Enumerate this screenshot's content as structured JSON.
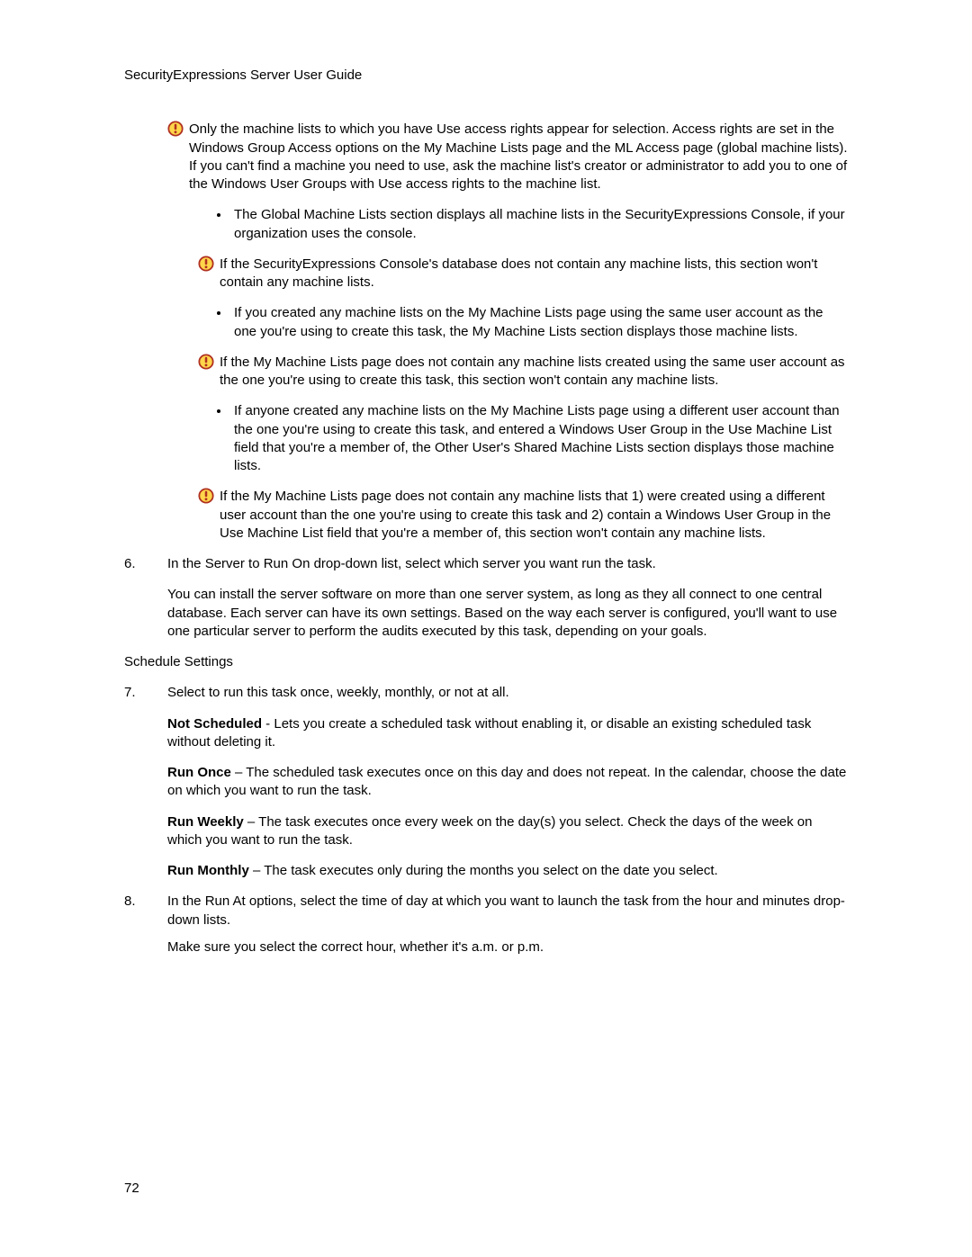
{
  "header": "SecurityExpressions Server User Guide",
  "note1": "Only the machine lists to which you have Use access rights appear for selection. Access rights are set in the Windows Group Access options on the My Machine Lists page and the ML Access page (global machine lists). If you can't find a machine you need to use, ask the machine list's creator or administrator to add you to one of the Windows User Groups with Use access rights to the machine list.",
  "bullet1": "The Global Machine Lists section displays all machine lists in the SecurityExpressions Console, if your organization uses the console.",
  "note2": "If the SecurityExpressions Console's database does not contain any machine lists, this section won't contain any machine lists.",
  "bullet2": "If you created any machine lists on the My Machine Lists page using the same user account as the one you're using to create this task, the My Machine Lists section displays those machine lists.",
  "note3": "If the My Machine Lists page does not contain any machine lists created using the same user account as the one you're using to create this task, this section won't contain any machine lists.",
  "bullet3": "If anyone created any machine lists on the My Machine Lists page using a different user account than the one you're using to create this task, and entered a Windows User Group in the Use Machine List field that you're a member of, the Other User's Shared Machine Lists section displays those machine lists.",
  "note4": "If the My Machine Lists page does not contain any machine lists that 1) were created using a different user account than the one you're using to create this task and 2) contain a Windows User Group in the Use Machine List field that you're a member of, this section won't contain any machine lists.",
  "step6num": "6.",
  "step6text": "In the Server to Run On drop-down list, select which server you want run the task.",
  "step6para": "You can install the server software on more than one server system, as long as they all connect to one central database. Each server can have its own settings. Based on the way each server is configured, you'll want to use one particular server to perform the audits executed by this task, depending on your goals.",
  "subhead": "Schedule Settings",
  "step7num": "7.",
  "step7text": "Select to run this task once, weekly, monthly, or not at all.",
  "opt1label": "Not Scheduled",
  "opt1text": " - Lets you create a scheduled task without enabling it, or disable an existing scheduled task without deleting it.",
  "opt2label": "Run Once",
  "opt2text": " – The scheduled task executes once on this day and does not repeat. In the calendar, choose the date on which you want to run the task.",
  "opt3label": "Run Weekly",
  "opt3text": " – The task executes once every week on the day(s) you select. Check the days of the week on which you want to run the task.",
  "opt4label": "Run Monthly",
  "opt4text": " – The task executes only during the months you select on the date you select.",
  "step8num": "8.",
  "step8text": "In the Run At options, select the time of day at which you want to launch the task from the hour and minutes drop-down lists.",
  "step8para": "Make sure you select the correct hour, whether it's a.m. or p.m.",
  "pagenum": "72"
}
